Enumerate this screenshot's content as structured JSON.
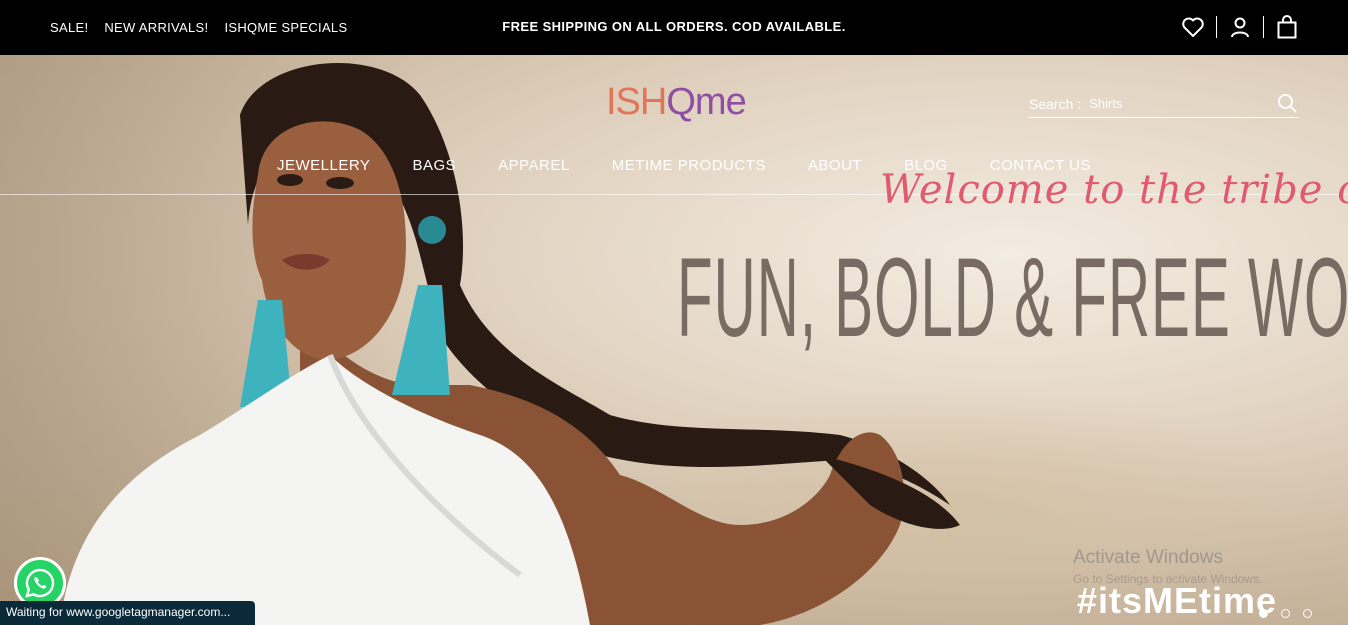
{
  "topbar": {
    "links": [
      "SALE!",
      "NEW ARRIVALS!",
      "ISHQME SPECIALS"
    ],
    "shipping": "FREE SHIPPING ON ALL ORDERS. COD AVAILABLE."
  },
  "logo": {
    "part1": "ISH",
    "part2": "Qme"
  },
  "search": {
    "label": "Search :",
    "placeholder": "Shirts"
  },
  "nav": [
    "JEWELLERY",
    "BAGS",
    "APPAREL",
    "METIME PRODUCTS",
    "ABOUT",
    "BLOG",
    "CONTACT US"
  ],
  "hero": {
    "welcome": "Welcome to the tribe of",
    "headline": "FUN, BOLD & FREE WOMEN",
    "hashtag": "#itsMEtime",
    "slides": 3,
    "active_slide": 1
  },
  "overlay": {
    "activate_title": "Activate Windows",
    "activate_sub": "Go to Settings to activate Windows."
  },
  "status": "Waiting for www.googletagmanager.com...",
  "colors": {
    "logo_ish": "#e2745a",
    "logo_qme": "#8e4ea3",
    "welcome": "#e05a70",
    "headline": "#776b64",
    "whatsapp": "#25d366"
  }
}
